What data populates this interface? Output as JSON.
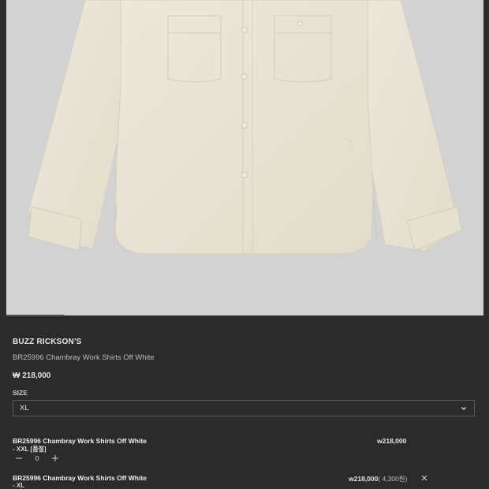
{
  "product": {
    "brand": "BUZZ RICKSON'S",
    "name": "BR25996 Chambray Work Shirts Off White",
    "price": "₩ 218,000"
  },
  "size": {
    "label": "SIZE",
    "selected": "XL"
  },
  "selected_options": [
    {
      "title": "BR25996 Chambray Work Shirts Off White",
      "sub": "- XXL [품절]",
      "quantity": "0",
      "price": "w218,000"
    },
    {
      "title": "BR25996 Chambray Work Shirts Off White",
      "sub": "- XL",
      "price": "w218,000",
      "price_note": "( 4,300원)"
    }
  ],
  "icons": {
    "size_dropdown": "chevron-down-icon",
    "qty_minus": "minus-icon",
    "qty_plus": "plus-icon",
    "remove": "close-icon"
  },
  "colors": {
    "background": "#2b2b2b",
    "image_background": "#d2d2d2",
    "shirt": "#e9e3d4"
  }
}
